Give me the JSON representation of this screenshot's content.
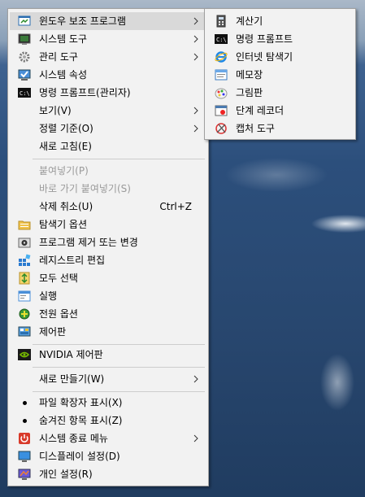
{
  "menu": {
    "items": [
      {
        "label": "윈도우 보조 프로그램",
        "icon": "window-tools-icon"
      },
      {
        "label": "시스템 도구",
        "icon": "system-tools-icon"
      },
      {
        "label": "관리 도구",
        "icon": "gear-icon"
      },
      {
        "label": "시스템 속성",
        "icon": "system-properties-icon"
      },
      {
        "label": "명령 프롬프트(관리자)",
        "icon": "cmd-icon"
      },
      {
        "label": "보기(V)"
      },
      {
        "label": "정렬 기준(O)"
      },
      {
        "label": "새로 고침(E)"
      },
      {
        "label": "붙여넣기(P)"
      },
      {
        "label": "바로 가기 붙여넣기(S)"
      },
      {
        "label": "삭제 취소(U)",
        "shortcut": "Ctrl+Z"
      },
      {
        "label": "탐색기 옵션",
        "icon": "folder-options-icon"
      },
      {
        "label": "프로그램 제거 또는 변경",
        "icon": "uninstall-icon"
      },
      {
        "label": "레지스트리 편집",
        "icon": "registry-icon"
      },
      {
        "label": "모두 선택",
        "icon": "select-all-icon"
      },
      {
        "label": "실행",
        "icon": "run-icon"
      },
      {
        "label": "전원 옵션",
        "icon": "power-options-icon"
      },
      {
        "label": "제어판",
        "icon": "control-panel-icon"
      },
      {
        "label": "NVIDIA 제어판",
        "icon": "nvidia-icon"
      },
      {
        "label": "새로 만들기(W)"
      },
      {
        "label": "파일 확장자 표시(X)"
      },
      {
        "label": "숨겨진 항목 표시(Z)"
      },
      {
        "label": "시스템 종료 메뉴",
        "icon": "shutdown-icon"
      },
      {
        "label": "디스플레이 설정(D)",
        "icon": "display-icon"
      },
      {
        "label": "개인 설정(R)",
        "icon": "personalize-icon"
      }
    ]
  },
  "submenu": {
    "items": [
      {
        "label": "계산기",
        "icon": "calculator-icon"
      },
      {
        "label": "명령 프롬프트",
        "icon": "cmd-icon"
      },
      {
        "label": "인터넷 탐색기",
        "icon": "internet-explorer-icon"
      },
      {
        "label": "메모장",
        "icon": "notepad-icon"
      },
      {
        "label": "그림판",
        "icon": "paint-icon"
      },
      {
        "label": "단계 레코더",
        "icon": "steps-recorder-icon"
      },
      {
        "label": "캡처 도구",
        "icon": "snipping-tool-icon"
      }
    ]
  },
  "colors": {
    "menu_bg": "#f2f2f2",
    "highlight": "#d9d9d9",
    "disabled_text": "#9a9a9a"
  }
}
